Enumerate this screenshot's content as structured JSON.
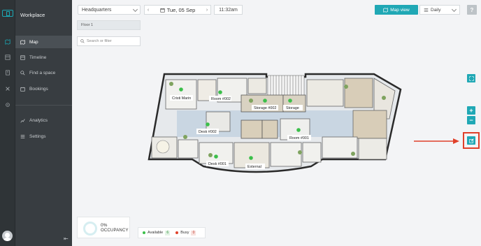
{
  "app": {
    "title": "Workplace"
  },
  "nav": {
    "items": [
      {
        "label": "Map",
        "icon": "map-icon",
        "active": true
      },
      {
        "label": "Timeline",
        "icon": "timeline-icon",
        "active": false
      },
      {
        "label": "Find a space",
        "icon": "search-icon",
        "active": false
      },
      {
        "label": "Bookings",
        "icon": "bookings-icon",
        "active": false
      },
      {
        "label": "Analytics",
        "icon": "analytics-icon",
        "active": false
      },
      {
        "label": "Settings",
        "icon": "settings-icon",
        "active": false
      }
    ]
  },
  "toolbar": {
    "location": "Headquarters",
    "date": "Tue, 05 Sep",
    "time": "11:32am",
    "map_view_label": "Map view",
    "period": "Daily",
    "help": "?"
  },
  "floor": {
    "label": "Floor 1"
  },
  "search": {
    "placeholder": "Search or filter"
  },
  "map": {
    "rooms": [
      {
        "label": "Cristi Marin"
      },
      {
        "label": "Room #002"
      },
      {
        "label": "Storage #002"
      },
      {
        "label": "Storage"
      },
      {
        "label": "Desk #002"
      },
      {
        "label": "Room #001"
      },
      {
        "label": "Desk #001"
      },
      {
        "label": "External"
      }
    ],
    "controls": {
      "zoom_in": "+",
      "zoom_out": "−"
    }
  },
  "occupancy": {
    "percent": "0%",
    "label": "OCCUPANCY",
    "ratio": 0
  },
  "legend": {
    "available": {
      "label": "Available",
      "count": "6"
    },
    "busy": {
      "label": "Busy",
      "count": "0"
    }
  },
  "colors": {
    "accent": "#20a8b5",
    "available": "#3bbf4a",
    "busy": "#e0402a",
    "highlight": "#e0402a"
  }
}
